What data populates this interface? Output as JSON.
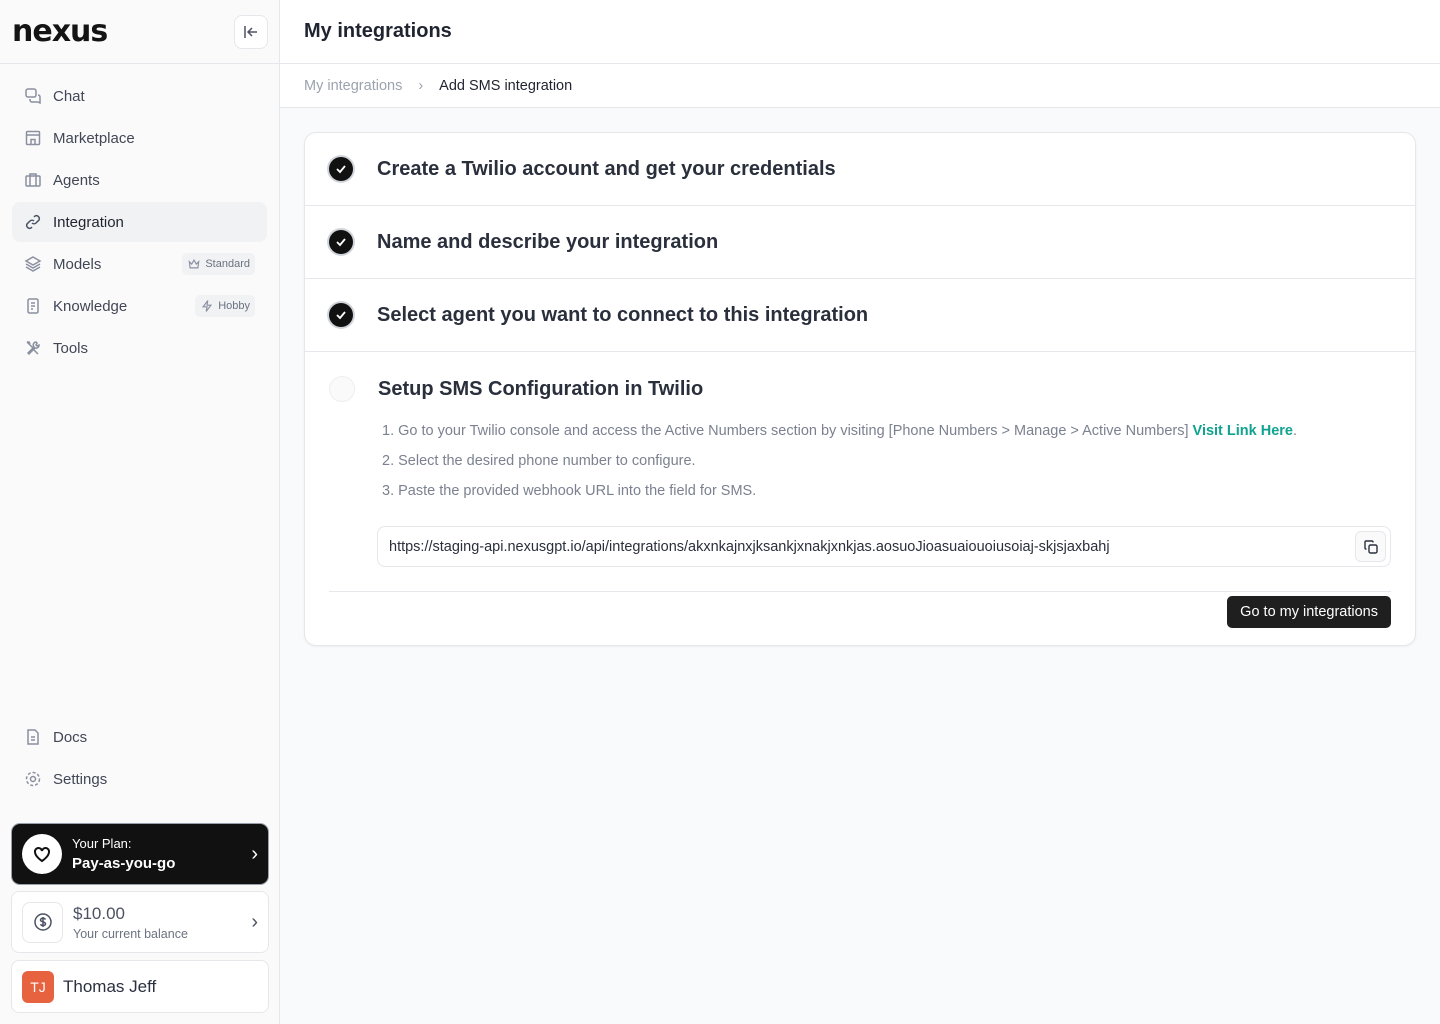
{
  "sidebar": {
    "logo": "nexus",
    "items": [
      {
        "label": "Chat",
        "icon": "chat-icon"
      },
      {
        "label": "Marketplace",
        "icon": "store-icon"
      },
      {
        "label": "Agents",
        "icon": "briefcase-icon"
      },
      {
        "label": "Integration",
        "icon": "link-icon",
        "active": true
      },
      {
        "label": "Models",
        "icon": "layers-icon",
        "badge": "Standard"
      },
      {
        "label": "Knowledge",
        "icon": "document-icon",
        "badge": "Hobby"
      },
      {
        "label": "Tools",
        "icon": "tools-icon"
      }
    ],
    "bottom": [
      {
        "label": "Docs"
      },
      {
        "label": "Settings"
      }
    ],
    "plan": {
      "label": "Your Plan:",
      "value": "Pay-as-you-go"
    },
    "balance": {
      "amount": "$10.00",
      "label": "Your current balance"
    },
    "user": {
      "initials": "TJ",
      "name": "Thomas Jeff",
      "color": "#e7623f"
    }
  },
  "header": {
    "title": "My integrations"
  },
  "breadcrumb": {
    "parent": "My integrations",
    "current": "Add SMS integration"
  },
  "steps": [
    {
      "title": "Create a Twilio account and get your credentials",
      "done": true
    },
    {
      "title": "Name and describe your integration",
      "done": true
    },
    {
      "title": "Select agent you want to connect to this integration",
      "done": true
    },
    {
      "title": "Setup SMS Configuration in Twilio",
      "done": false
    }
  ],
  "instructions": {
    "line1": "1. Go to your Twilio console and access the Active Numbers section by visiting [Phone Numbers > Manage > Active Numbers]",
    "link": "Visit Link Here",
    "line2": "2. Select the desired phone number to configure.",
    "line3": "3. Paste the provided webhook URL into the field for SMS."
  },
  "webhook_url": "https://staging-api.nexusgpt.io/api/integrations/akxnkajnxjksankjxnakjxnkjas.aosuoJioasuaiouoiusoiaj-skjsjaxbahj",
  "actions": {
    "go": "Go to my integrations"
  },
  "colors": {
    "accent": "#10a38f"
  }
}
